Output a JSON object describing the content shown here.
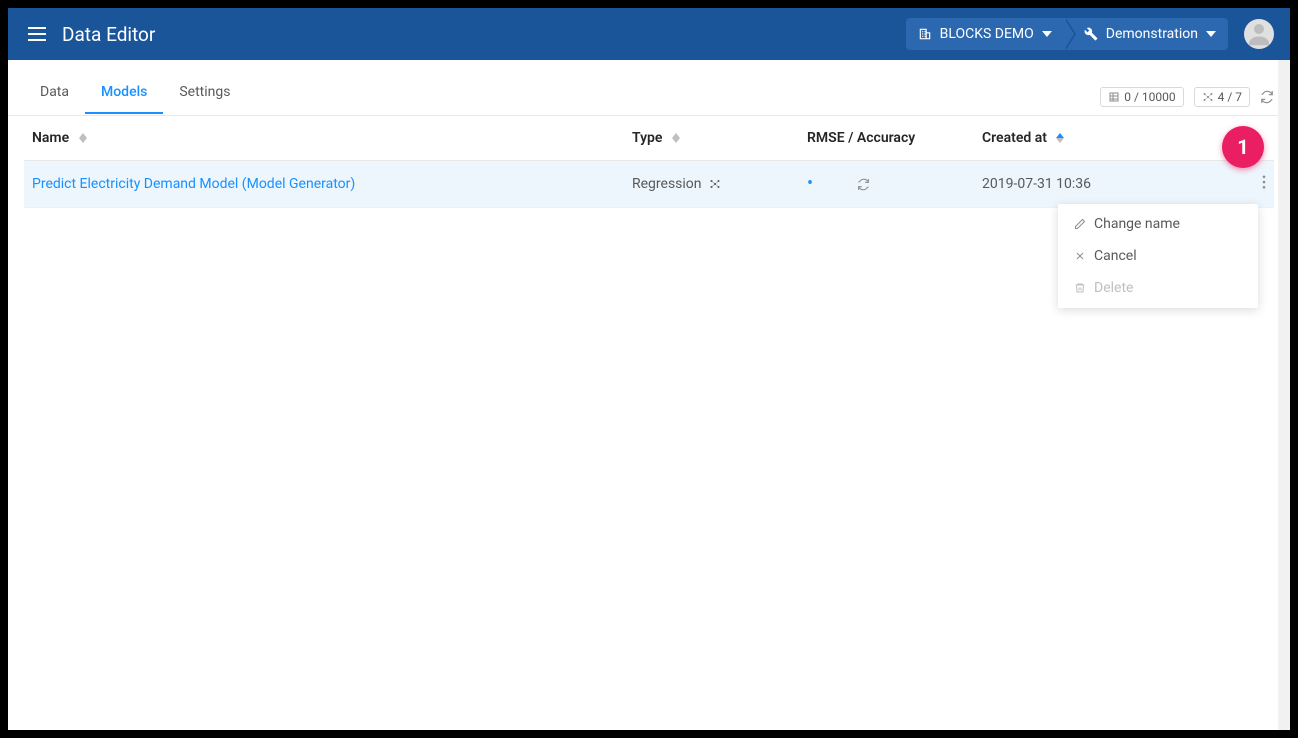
{
  "header": {
    "app_title": "Data Editor",
    "breadcrumb": {
      "project_label": "BLOCKS DEMO",
      "project_sub_label": "Demonstration"
    }
  },
  "tabs": {
    "data": "Data",
    "models": "Models",
    "settings": "Settings",
    "active": "models"
  },
  "stats": {
    "data_count": "0 / 10000",
    "model_count": "4 / 7"
  },
  "table": {
    "columns": {
      "name": "Name",
      "type": "Type",
      "rmse": "RMSE / Accuracy",
      "created_at": "Created at"
    },
    "rows": [
      {
        "name": "Predict Electricity Demand Model (Model Generator)",
        "type": "Regression",
        "rmse_state": "loading",
        "created_at": "2019-07-31 10:36"
      }
    ]
  },
  "context_menu": {
    "change_name": "Change name",
    "cancel": "Cancel",
    "delete": "Delete"
  },
  "badge": {
    "number": "1"
  }
}
